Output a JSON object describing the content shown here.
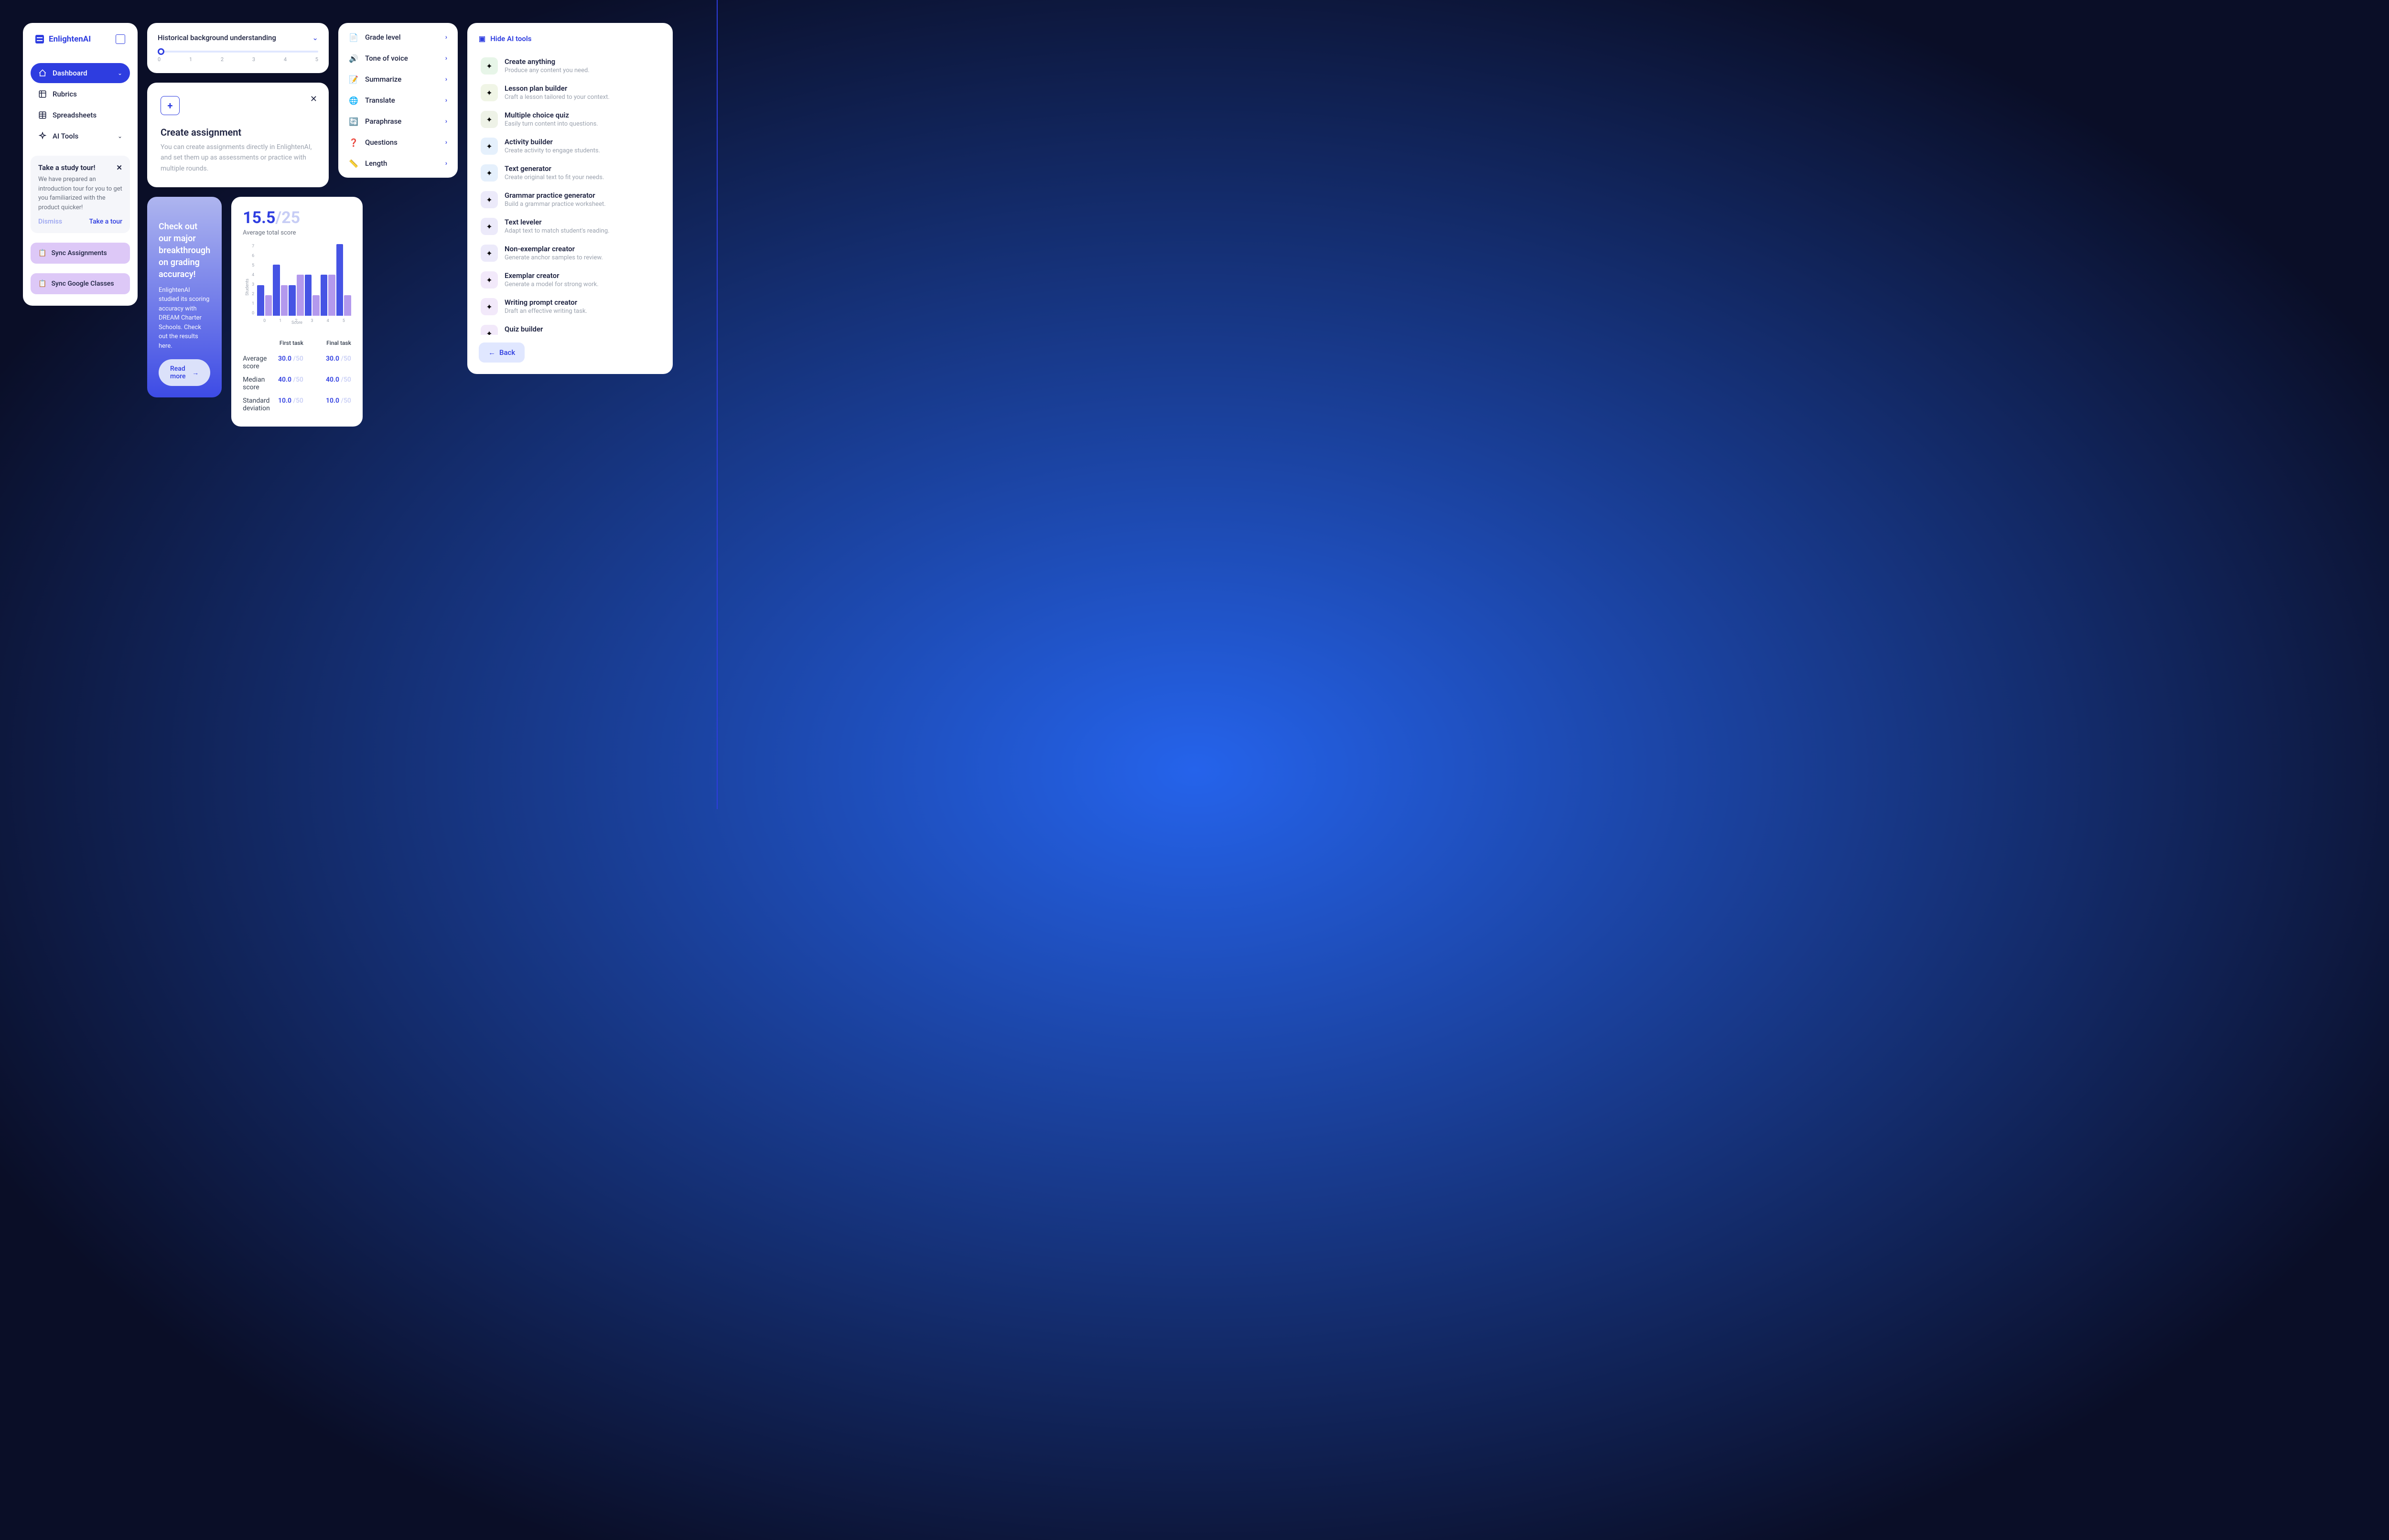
{
  "brand": "EnlightenAI",
  "nav": [
    {
      "label": "Dashboard",
      "active": true,
      "expandable": true
    },
    {
      "label": "Rubrics",
      "active": false,
      "expandable": false
    },
    {
      "label": "Spreadsheets",
      "active": false,
      "expandable": false
    },
    {
      "label": "AI Tools",
      "active": false,
      "expandable": true
    }
  ],
  "tour": {
    "title": "Take a study tour!",
    "body": "We have prepared an introduction tour for you to get you familiarized with the product quicker!",
    "dismiss": "Dismiss",
    "take": "Take a tour"
  },
  "sync": {
    "assignments": "Sync Assignments",
    "google": "Sync Google Classes"
  },
  "slider": {
    "title": "Historical background understanding",
    "ticks": [
      "0",
      "1",
      "2",
      "3",
      "4",
      "5"
    ],
    "value": 0
  },
  "create": {
    "title": "Create assignment",
    "body": "You can create assignments directly in EnlightenAI, and set them up as assessments or practice with multiple rounds."
  },
  "promo": {
    "title": "Check out our major breakthrough on grading accuracy!",
    "body": "EnlightenAI studied its scoring accuracy with DREAM Charter Schools. Check out the results here.",
    "cta": "Read more"
  },
  "stats": {
    "score": "15.5",
    "max": "/25",
    "label": "Average total score",
    "cols": [
      "First task",
      "Final task"
    ],
    "rows": [
      {
        "label": "Average score",
        "vals": [
          "30.0",
          "30.0"
        ],
        "denom": "/50"
      },
      {
        "label": "Median score",
        "vals": [
          "40.0",
          "40.0"
        ],
        "denom": "/50"
      },
      {
        "label": "Standard deviation",
        "vals": [
          "10.0",
          "10.0"
        ],
        "denom": "/50"
      }
    ]
  },
  "chart_data": {
    "type": "bar",
    "title": "Average total score",
    "xlabel": "Score",
    "ylabel": "Students",
    "ylim": [
      0,
      7
    ],
    "categories": [
      "0",
      "1",
      "2",
      "3",
      "4",
      "5"
    ],
    "series": [
      {
        "name": "First task",
        "values": [
          3,
          5,
          3,
          4,
          4,
          7
        ]
      },
      {
        "name": "Final task",
        "values": [
          2,
          3,
          4,
          2,
          4,
          2
        ]
      }
    ]
  },
  "tools": [
    {
      "label": "Grade level",
      "icon": "grade"
    },
    {
      "label": "Tone of voice",
      "icon": "tone"
    },
    {
      "label": "Summarize",
      "icon": "summarize"
    },
    {
      "label": "Translate",
      "icon": "translate"
    },
    {
      "label": "Paraphrase",
      "icon": "paraphrase"
    },
    {
      "label": "Questions",
      "icon": "questions"
    },
    {
      "label": "Length",
      "icon": "length"
    }
  ],
  "ai": {
    "hide": "Hide AI tools",
    "back": "Back",
    "items": [
      {
        "title": "Create anything",
        "sub": "Produce any content you need.",
        "hue": "#e7f5e8"
      },
      {
        "title": "Lesson plan builder",
        "sub": "Craft a lesson tailored to your context.",
        "hue": "#f0f5e6"
      },
      {
        "title": "Multiple choice quiz",
        "sub": "Easily turn content into questions.",
        "hue": "#eef2e7"
      },
      {
        "title": "Activity builder",
        "sub": "Create activity to engage students.",
        "hue": "#e5f0fc"
      },
      {
        "title": "Text generator",
        "sub": "Create original text to fit your needs.",
        "hue": "#e5f0fc"
      },
      {
        "title": "Grammar practice generator",
        "sub": "Build a grammar practice worksheet.",
        "hue": "#eceafa"
      },
      {
        "title": "Text leveler",
        "sub": "Adapt text to match student's reading.",
        "hue": "#eceafa"
      },
      {
        "title": "Non-exemplar creator",
        "sub": "Generate anchor samples to review.",
        "hue": "#eceafa"
      },
      {
        "title": "Exemplar creator",
        "sub": "Generate a model for strong work.",
        "hue": "#f2e9fa"
      },
      {
        "title": "Writing prompt creator",
        "sub": "Draft an effective writing task.",
        "hue": "#f2e9fa"
      },
      {
        "title": "Quiz builder",
        "sub": "",
        "hue": "#f2e9fa"
      }
    ]
  }
}
